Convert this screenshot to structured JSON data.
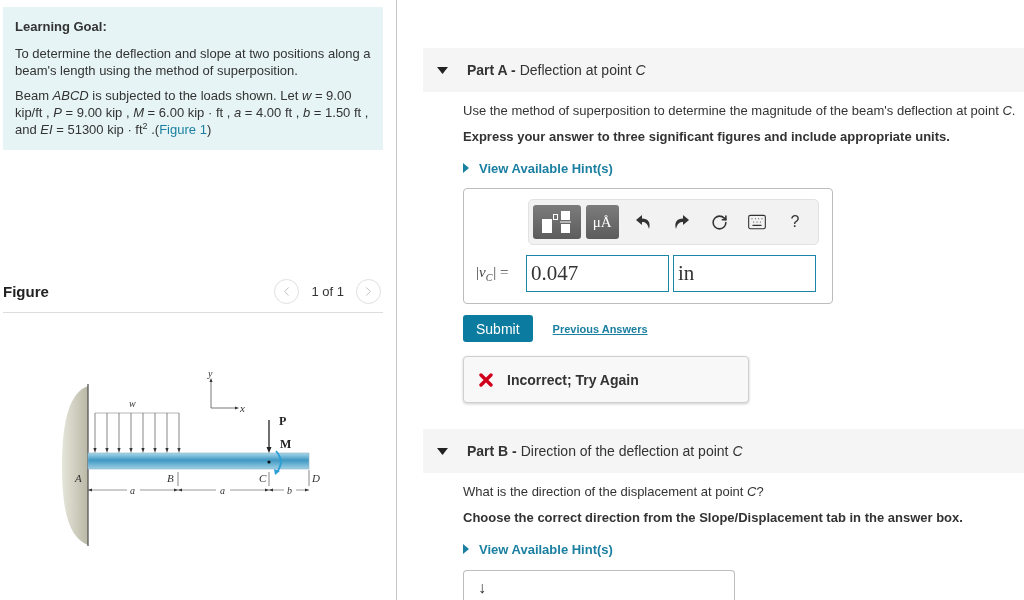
{
  "learning_goal": {
    "title": "Learning Goal:",
    "paragraphs": [
      "To determine the deflection and slope at two positions along a beam's length using the method of superposition."
    ],
    "statement": "Beam *ABCD* is subjected to the loads shown. Let *w* = 9.00 kip/ft , *P* = 9.00 kip , *M* = 6.00 kip · ft , *a* = 4.00 ft , *b* = 1.50 ft , and *EI* = 51300 kip · ft$^{2}$ .(",
    "figure_link": "Figure 1",
    "statement_end": ")"
  },
  "figure": {
    "title": "Figure",
    "pager": "1 of 1",
    "nav_buttons": [
      {
        "kind": "prev",
        "disabled": true
      },
      {
        "kind": "next",
        "disabled": true
      }
    ],
    "diagram_labels": {
      "load": "w",
      "axis_y": "y",
      "axis_x": "x",
      "force": "P",
      "moment": "M",
      "support": "A",
      "point_b": "B",
      "point_c": "C",
      "end": "D",
      "span_1": "a",
      "span_2": "a",
      "span_3": "b"
    }
  },
  "parts": [
    {
      "kind": "answered",
      "title": "**Part A -** Deflection at point *C*",
      "expanded": true,
      "prompt": "Use the method of superposition to determine the magnitude of the beam's deflection at point *C*.",
      "instruction": "Express your answer to three significant figures and include appropriate units.",
      "hint": {
        "label": "View Available Hint(s)",
        "expanded": false
      },
      "answer": {
        "toolbar": [
          {
            "kind": "templates"
          },
          {
            "kind": "units",
            "label": "μÅ"
          },
          {
            "kind": "undo"
          },
          {
            "kind": "redo"
          },
          {
            "kind": "reset"
          },
          {
            "kind": "keyboard"
          },
          {
            "kind": "help",
            "label": "?"
          }
        ],
        "label": "|*v*$_{C}$| =",
        "value": "0.047",
        "units": "in"
      },
      "submit": "Submit",
      "previous_answers": "Previous Answers",
      "feedback": {
        "kind": "incorrect",
        "text": "Incorrect; Try Again"
      }
    },
    {
      "kind": "pending",
      "title": "**Part B -** Direction of the deflection at point *C*",
      "expanded": true,
      "prompt": "What is the direction of the displacement at point *C*?",
      "instruction": "Choose the correct direction from the Slope/Displacement tab in the answer box.",
      "hint": {
        "label": "View Available Hint(s)",
        "expanded": false
      },
      "answer_preview": "↓"
    }
  ]
}
